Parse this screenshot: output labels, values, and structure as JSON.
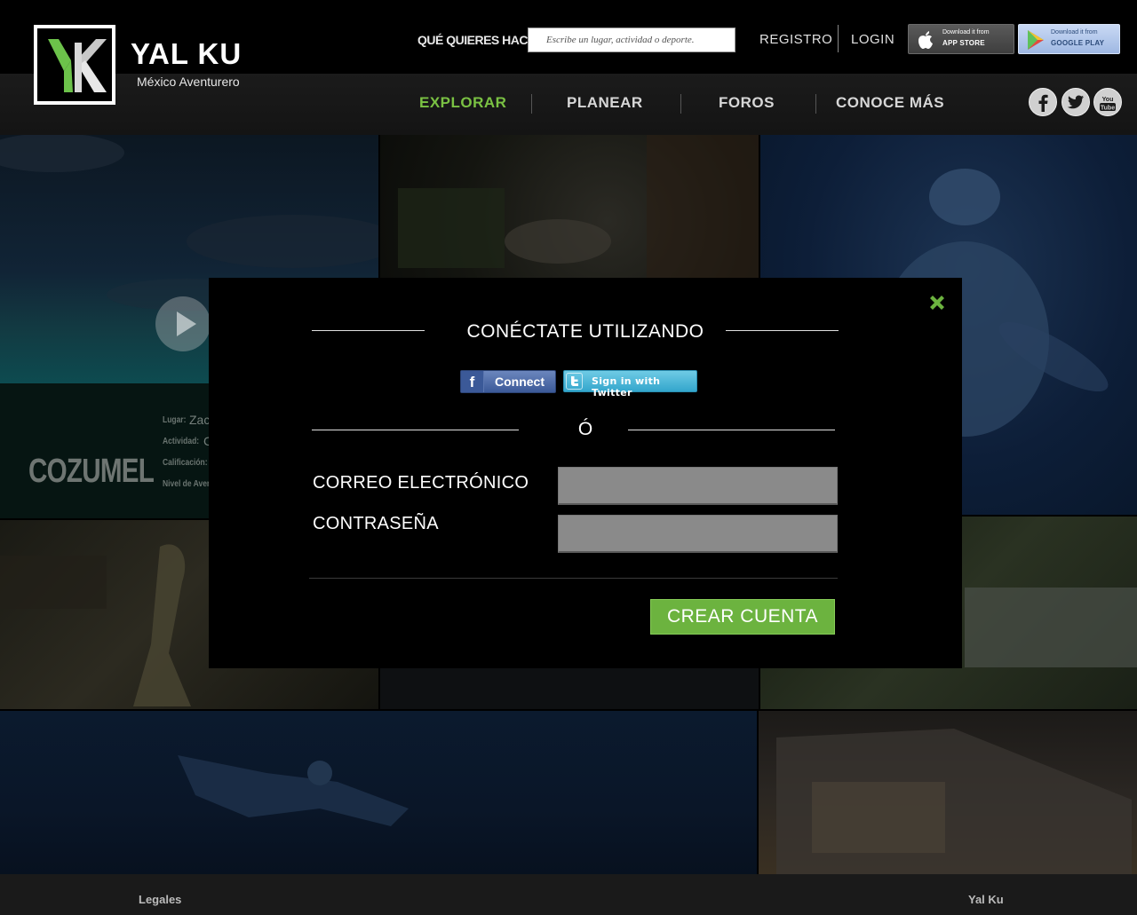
{
  "header": {
    "brand_name": "YAL KU",
    "brand_tagline": "México Aventurero",
    "search_label": "QUÉ QUIERES HACER?",
    "search_placeholder": "Escribe un lugar, actividad o deporte.",
    "registro": "REGISTRO",
    "login": "LOGIN",
    "app_store": {
      "small": "Download it from",
      "big": "APP STORE"
    },
    "google_play": {
      "small": "Download it from",
      "big": "GOOGLE PLAY"
    }
  },
  "nav": {
    "items": [
      {
        "label": "EXPLORAR",
        "active": true
      },
      {
        "label": "PLANEAR",
        "active": false
      },
      {
        "label": "FOROS",
        "active": false
      },
      {
        "label": "CONOCE MÁS",
        "active": false
      }
    ]
  },
  "social": [
    "facebook-icon",
    "twitter-icon",
    "youtube-icon"
  ],
  "featured": {
    "title": "COZUMEL",
    "fields": [
      {
        "label": "Lugar:",
        "value": "Zac"
      },
      {
        "label": "Actividad:",
        "value": "C"
      },
      {
        "label": "Calificación:",
        "value": ""
      },
      {
        "label": "Nivel de Aven",
        "value": ""
      }
    ]
  },
  "modal": {
    "title": "CONÉCTATE UTILIZANDO",
    "facebook_connect": "Connect",
    "twitter_signin": "Sign in with Twitter",
    "or": "Ó",
    "email_label": "CORREO ELECTRÓNICO",
    "password_label": "CONTRASEÑA",
    "email_value": "",
    "password_value": "",
    "create_account": "CREAR CUENTA"
  },
  "footer": {
    "legal": "Legales",
    "brand": "Yal Ku"
  },
  "colors": {
    "accent": "#7ac143",
    "button_green": "#6cb33f",
    "facebook": "#3b5998",
    "twitter": "#33a6cc"
  }
}
